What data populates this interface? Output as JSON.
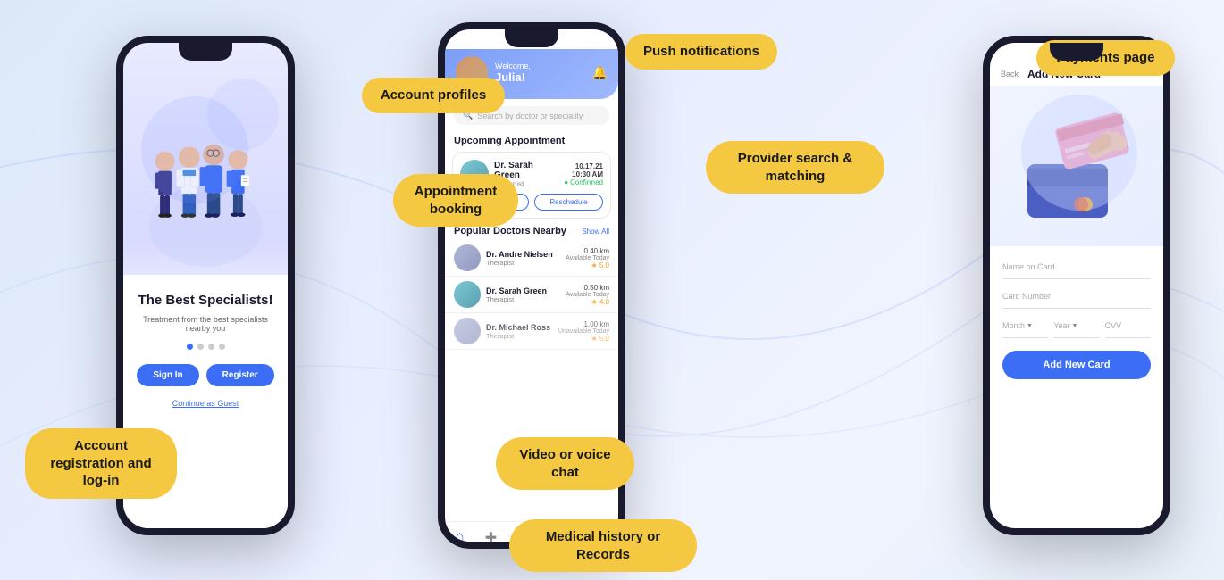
{
  "background": {
    "gradient_start": "#dce8f8",
    "gradient_end": "#e8f0fa"
  },
  "labels": {
    "push_notifications": "Push notifications",
    "account_profiles": "Account profiles",
    "appointment_booking": "Appointment\nbooking",
    "account_registration": "Account registration\nand log-in",
    "provider_search": "Provider search & matching",
    "video_voice_chat": "Video or voice chat",
    "medical_history": "Medical history or Records",
    "payments_page": "Payments page"
  },
  "phone1": {
    "title": "The Best Specialists!",
    "subtitle": "Treatment from the best specialists nearby you",
    "signin_label": "Sign In",
    "register_label": "Register",
    "guest_label": "Continue as Guest"
  },
  "phone2": {
    "welcome": "Welcome,",
    "name": "Julia!",
    "search_placeholder": "Search by doctor or speciality",
    "upcoming_title": "Upcoming Appointment",
    "doctor1_name": "Dr. Sarah Green",
    "doctor1_spec": "Therapist",
    "doctor1_date": "10.17.21",
    "doctor1_time": "10:30 AM",
    "doctor1_status": "Confirmed",
    "cancel_label": "Cancel",
    "reschedule_label": "Reschedule",
    "nearby_title": "Popular Doctors Nearby",
    "show_all": "Show All",
    "nearby_doc1_name": "Dr. Andre Nielsen",
    "nearby_doc1_spec": "Therapist",
    "nearby_doc1_dist": "0.40 km",
    "nearby_doc1_avail": "Available Today",
    "nearby_doc1_rating": "★ 5.0",
    "nearby_doc2_name": "Dr. Sarah Green",
    "nearby_doc2_spec": "Therapist",
    "nearby_doc2_dist": "0.50 km",
    "nearby_doc2_avail": "Available Today",
    "nearby_doc2_rating": "★ 4.0",
    "nearby_doc3_dist": "1.00 km",
    "nearby_doc3_avail": "Unavailable Today",
    "nearby_doc3_rating": "★ 5.0"
  },
  "phone3": {
    "back_label": "Back",
    "title": "Add New Card",
    "name_placeholder": "Name on Card",
    "card_placeholder": "Card Number",
    "month_label": "Month",
    "year_label": "Year",
    "cvv_label": "CVV",
    "add_card_label": "Add New Card"
  }
}
